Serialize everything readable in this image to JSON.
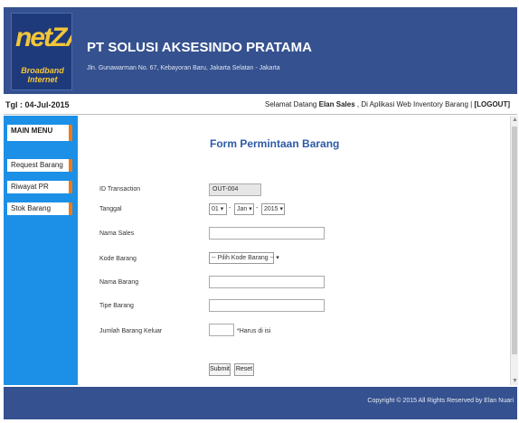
{
  "header": {
    "logo_text": "netZAP",
    "logo_tagline": "Broadband Internet",
    "company": "PT SOLUSI AKSESINDO PRATAMA",
    "address": "Jln. Gunawarman No. 67, Kebayoran Baru, Jakarta Selatan - Jakarta"
  },
  "topbar": {
    "date": "Tgl : 04-Jul-2015",
    "welcome_prefix": "Selamat Datang",
    "user": "Elan Sales",
    "welcome_suffix": ", Di Aplikasi Web Inventory Barang |",
    "logout": "[LOGOUT]"
  },
  "sidebar": {
    "heading": "MAIN MENU",
    "items": [
      {
        "label": "Request Barang"
      },
      {
        "label": "Riwayat PR"
      },
      {
        "label": "Stok Barang"
      }
    ]
  },
  "form": {
    "title": "Form Permintaan Barang",
    "labels": {
      "id_transaction": "ID Transaction",
      "tanggal": "Tanggal",
      "nama_sales": "Nama Sales",
      "kode_barang": "Kode Barang",
      "nama_barang": "Nama Barang",
      "tipe_barang": "Tipe Barang",
      "jumlah": "Jumlah Barang Keluar"
    },
    "id_value": "OUT-004",
    "date_day": "01",
    "date_month": "Jan",
    "date_year": "2015",
    "date_separator": "-",
    "kode_selected": "-- Pilih Kode Barang --",
    "nama_sales_value": "",
    "nama_barang_value": "",
    "tipe_barang_value": "",
    "jumlah_value": "",
    "required_hint": "*Harus di isi",
    "submit_label": "Submit",
    "reset_label": "Reset",
    "dropdown_arrow": "▾"
  },
  "footer": {
    "copyright": "Copyright © 2015 All Rights Reserved by Elan Nuari"
  }
}
